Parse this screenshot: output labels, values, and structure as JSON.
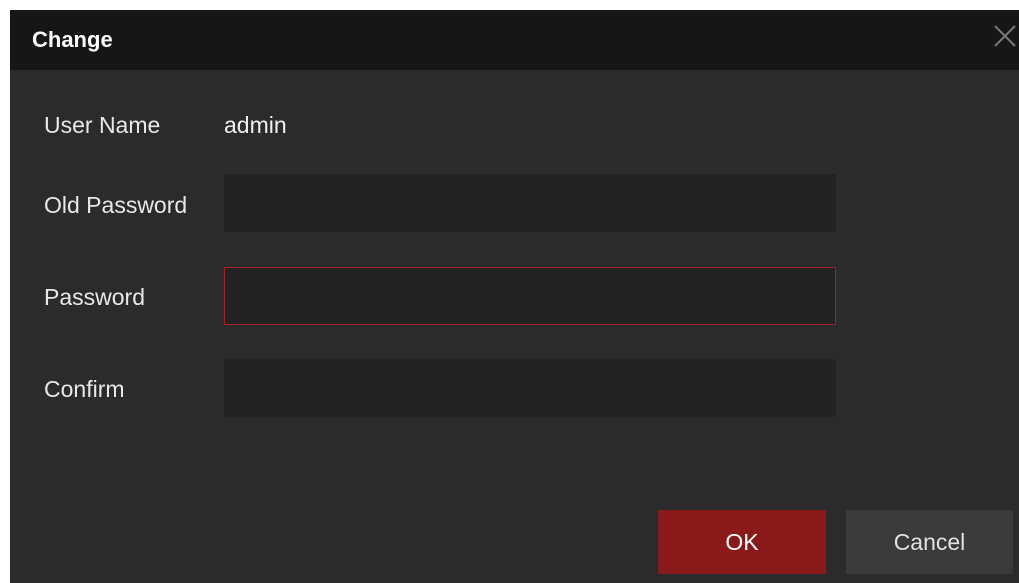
{
  "dialog": {
    "title": "Change",
    "close_icon": "close-icon"
  },
  "form": {
    "user_name_label": "User Name",
    "user_name_value": "admin",
    "old_password_label": "Old Password",
    "old_password_value": "",
    "password_label": "Password",
    "password_value": "",
    "confirm_label": "Confirm",
    "confirm_value": ""
  },
  "buttons": {
    "ok_label": "OK",
    "cancel_label": "Cancel"
  },
  "colors": {
    "accent": "#8a1a1a",
    "error_border": "#a12121",
    "dialog_bg": "#2b2b2b",
    "titlebar_bg": "#161616"
  }
}
